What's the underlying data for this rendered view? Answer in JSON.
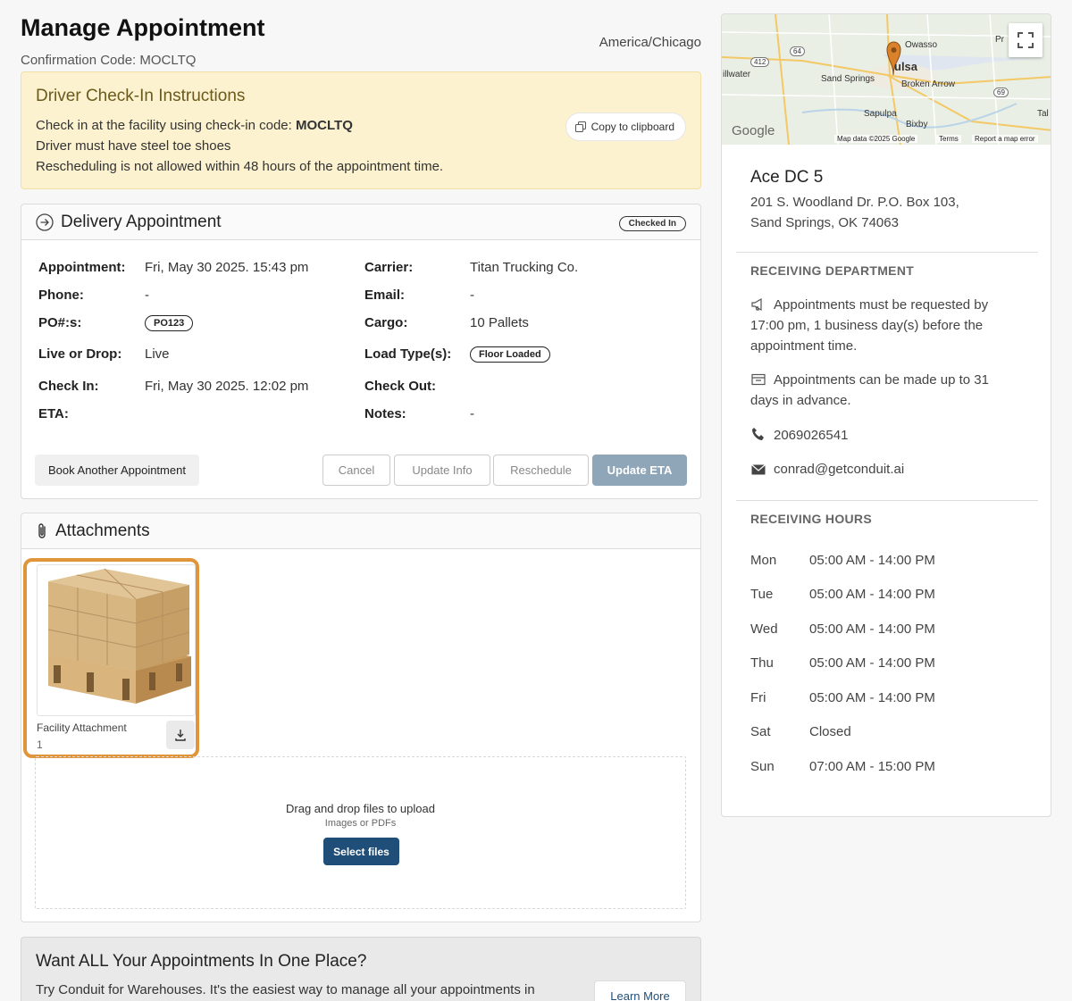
{
  "header": {
    "title": "Manage Appointment",
    "confirmation": "Confirmation Code: MOCLTQ",
    "timezone": "America/Chicago"
  },
  "instructions": {
    "title": "Driver Check-In Instructions",
    "line1_prefix": "Check in at the facility using check-in code: ",
    "line1_code": "MOCLTQ",
    "line2": "Driver must have steel toe shoes",
    "line3": "Rescheduling is not allowed within 48 hours of the appointment time.",
    "copy_label": "Copy to clipboard"
  },
  "appointment": {
    "title": "Delivery Appointment",
    "status": "Checked In",
    "fields": {
      "appointment_label": "Appointment:",
      "appointment_value": "Fri, May 30 2025. 15:43 pm",
      "carrier_label": "Carrier:",
      "carrier_value": "Titan Trucking Co.",
      "phone_label": "Phone:",
      "phone_value": "-",
      "email_label": "Email:",
      "email_value": "-",
      "po_label": "PO#:s:",
      "po_value": "PO123",
      "cargo_label": "Cargo:",
      "cargo_value": "10 Pallets",
      "livedrop_label": "Live or Drop:",
      "livedrop_value": "Live",
      "loadtype_label": "Load Type(s):",
      "loadtype_value": "Floor Loaded",
      "checkin_label": "Check In:",
      "checkin_value": "Fri, May 30 2025. 12:02 pm",
      "checkout_label": "Check Out:",
      "eta_label": "ETA:",
      "notes_label": "Notes:",
      "notes_value": "-"
    },
    "buttons": {
      "book": "Book Another Appointment",
      "cancel": "Cancel",
      "update_info": "Update Info",
      "reschedule": "Reschedule",
      "update_eta": "Update ETA"
    }
  },
  "attachments": {
    "title": "Attachments",
    "file_name": "Facility Attachment",
    "file_number": "1",
    "drop_title": "Drag and drop files to upload",
    "drop_sub": "Images or PDFs",
    "select_label": "Select files"
  },
  "promo": {
    "title": "Want ALL Your Appointments In One Place?",
    "text": "Try Conduit for Warehouses. It's the easiest way to manage all your appointments in",
    "learn_more": "Learn More"
  },
  "map": {
    "labels": {
      "owasso": "Owasso",
      "tulsa": "ulsa",
      "sand_springs": "Sand Springs",
      "broken_arrow": "Broken Arrow",
      "sapulpa": "Sapulpa",
      "bixby": "Bixby",
      "sillwater": "illwater",
      "pr": "Pr",
      "tal": "Tal",
      "r64": "64",
      "r412": "412",
      "r69": "69",
      "google": "Google"
    },
    "footer": {
      "data": "Map data ©2025 Google",
      "terms": "Terms",
      "report": "Report a map error"
    }
  },
  "facility": {
    "name": "Ace DC 5",
    "address1": "201 S. Woodland Dr. P.O. Box 103,",
    "address2": "Sand Springs, OK 74063",
    "receiving_title": "RECEIVING DEPARTMENT",
    "note1": "Appointments must be requested by 17:00 pm, 1 business day(s) before the appointment time.",
    "note2": "Appointments can be made up to 31 days in advance.",
    "phone": "2069026541",
    "email": "conrad@getconduit.ai",
    "hours_title": "RECEIVING HOURS",
    "hours": [
      {
        "day": "Mon",
        "time": "05:00 AM - 14:00 PM"
      },
      {
        "day": "Tue",
        "time": "05:00 AM - 14:00 PM"
      },
      {
        "day": "Wed",
        "time": "05:00 AM - 14:00 PM"
      },
      {
        "day": "Thu",
        "time": "05:00 AM - 14:00 PM"
      },
      {
        "day": "Fri",
        "time": "05:00 AM - 14:00 PM"
      },
      {
        "day": "Sat",
        "time": "Closed"
      },
      {
        "day": "Sun",
        "time": "07:00 AM - 15:00 PM"
      }
    ]
  },
  "colors": {
    "accent": "#1f4e79",
    "highlight": "#e0953a",
    "instructions_bg": "#fcf2cf",
    "eta_button": "#8fa5b8"
  }
}
